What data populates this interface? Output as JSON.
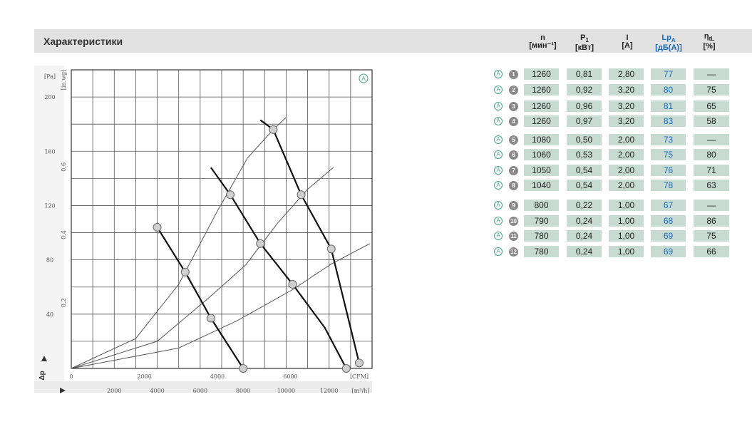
{
  "header": {
    "title": "Характеристики"
  },
  "columns": [
    {
      "name": "n",
      "unit": "[мин⁻¹]",
      "blue": false
    },
    {
      "name": "P",
      "sub": "1",
      "unit": "[кВт]",
      "blue": false
    },
    {
      "name": "I",
      "unit": "[A]",
      "blue": false
    },
    {
      "name": "Lp",
      "sub": "A",
      "unit": "[дБ(А)]",
      "blue": true
    },
    {
      "name": "η",
      "sub": "tL",
      "unit": "[%]",
      "blue": false
    }
  ],
  "rows": [
    {
      "id": "1",
      "n": "1260",
      "p": "0,81",
      "i": "2,80",
      "lp": "77",
      "eta": "—"
    },
    {
      "id": "2",
      "n": "1260",
      "p": "0,92",
      "i": "3,20",
      "lp": "80",
      "eta": "75"
    },
    {
      "id": "3",
      "n": "1260",
      "p": "0,96",
      "i": "3,20",
      "lp": "81",
      "eta": "65"
    },
    {
      "id": "4",
      "n": "1260",
      "p": "0,97",
      "i": "3,20",
      "lp": "83",
      "eta": "58"
    },
    {
      "id": "5",
      "n": "1080",
      "p": "0,50",
      "i": "2,00",
      "lp": "73",
      "eta": "—"
    },
    {
      "id": "6",
      "n": "1060",
      "p": "0,53",
      "i": "2,00",
      "lp": "75",
      "eta": "80"
    },
    {
      "id": "7",
      "n": "1050",
      "p": "0,54",
      "i": "2,00",
      "lp": "76",
      "eta": "71"
    },
    {
      "id": "8",
      "n": "1040",
      "p": "0,54",
      "i": "2,00",
      "lp": "78",
      "eta": "63"
    },
    {
      "id": "9",
      "n": "800",
      "p": "0,22",
      "i": "1,00",
      "lp": "67",
      "eta": "—"
    },
    {
      "id": "10",
      "n": "790",
      "p": "0,24",
      "i": "1,00",
      "lp": "68",
      "eta": "86"
    },
    {
      "id": "11",
      "n": "780",
      "p": "0,24",
      "i": "1,00",
      "lp": "69",
      "eta": "75"
    },
    {
      "id": "12",
      "n": "780",
      "p": "0,24",
      "i": "1,00",
      "lp": "69",
      "eta": "66"
    }
  ],
  "row_marker": "A",
  "colors": {
    "title_bar": "#e1e1e1",
    "cell": "#c7dbd3",
    "blue": "#1a6bb5",
    "marker_green": "#4aa386",
    "number_grey": "#8a8a8a"
  },
  "chart_data": {
    "type": "line",
    "xlabel": "[m³/h]",
    "ylabel": "Δp",
    "corner_marker": "A",
    "x_secondary_label": "[CFM]",
    "x_ticks_m3h": [
      "2000",
      "4000",
      "6000",
      "8000",
      "10000",
      "12000"
    ],
    "x_ticks_cfm": [
      "0",
      "2000",
      "4000",
      "6000"
    ],
    "y_ticks_pa": [
      "40",
      "80",
      "120",
      "160",
      "200"
    ],
    "y_ticks_inwg": [
      "0,2",
      "0,4",
      "0,6"
    ],
    "y_unit_pa": "[Pa]",
    "y_unit_inwg": "[in.wg]",
    "xlim": [
      0,
      14000
    ],
    "ylim": [
      0,
      220
    ],
    "series": [
      {
        "points": [
          [
            4000,
            104
          ],
          [
            5300,
            71
          ],
          [
            6500,
            37
          ],
          [
            8000,
            0
          ]
        ]
      },
      {
        "points": [
          [
            6500,
            148
          ],
          [
            7400,
            128
          ],
          [
            8800,
            92
          ],
          [
            10300,
            62
          ],
          [
            11800,
            30
          ],
          [
            12800,
            0
          ]
        ]
      },
      {
        "points": [
          [
            8800,
            183
          ],
          [
            9400,
            176
          ],
          [
            10700,
            128
          ],
          [
            12100,
            88
          ],
          [
            13400,
            4
          ]
        ]
      }
    ],
    "system_curves": [
      {
        "points": [
          [
            0,
            0
          ],
          [
            3000,
            22
          ],
          [
            5000,
            62
          ],
          [
            6800,
            116
          ],
          [
            8200,
            155
          ],
          [
            9400,
            176
          ],
          [
            10000,
            185
          ]
        ]
      },
      {
        "points": [
          [
            0,
            0
          ],
          [
            4000,
            20
          ],
          [
            6400,
            52
          ],
          [
            8100,
            76
          ],
          [
            9600,
            107
          ],
          [
            11000,
            132
          ],
          [
            12200,
            148
          ]
        ]
      },
      {
        "points": [
          [
            0,
            0
          ],
          [
            5000,
            15
          ],
          [
            7700,
            35
          ],
          [
            10300,
            58
          ],
          [
            12100,
            77
          ],
          [
            13900,
            92
          ]
        ]
      }
    ],
    "operating_points": [
      [
        8000,
        0
      ],
      [
        6500,
        37
      ],
      [
        5300,
        71
      ],
      [
        4000,
        104
      ],
      [
        12800,
        0
      ],
      [
        10300,
        62
      ],
      [
        8800,
        92
      ],
      [
        7400,
        128
      ],
      [
        13400,
        4
      ],
      [
        12100,
        88
      ],
      [
        10700,
        128
      ],
      [
        9400,
        176
      ]
    ]
  }
}
